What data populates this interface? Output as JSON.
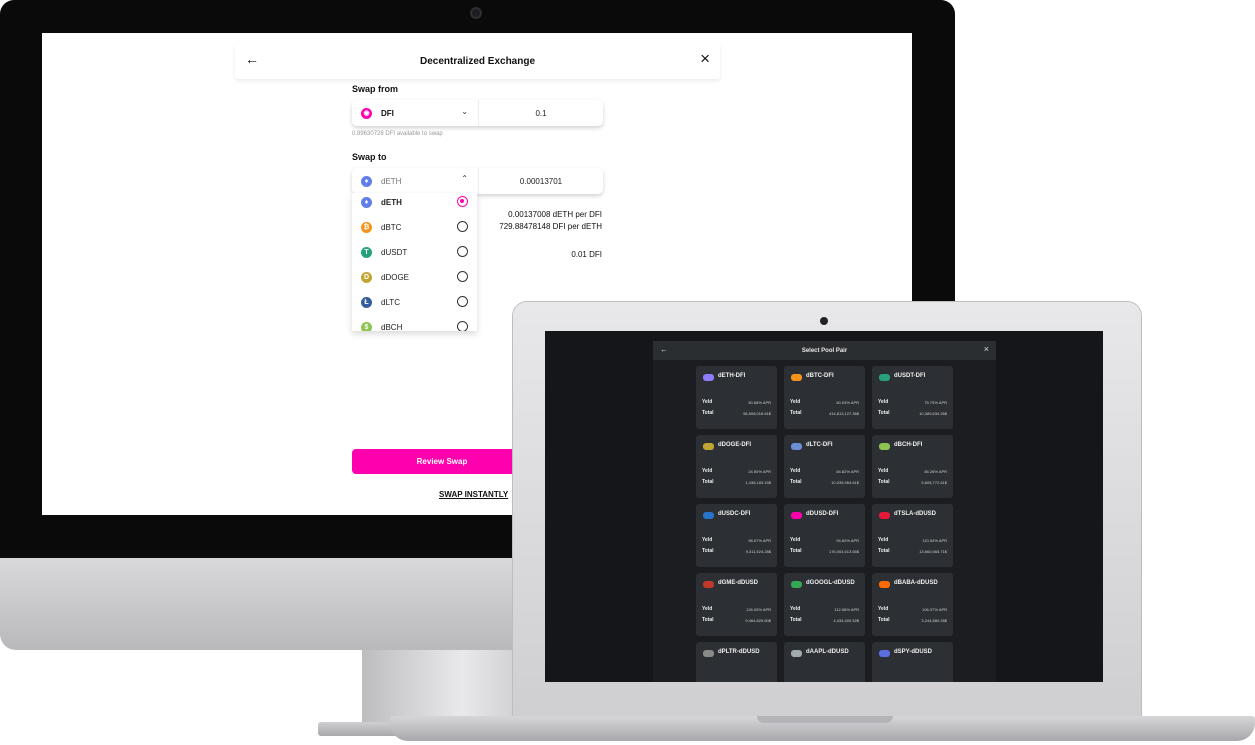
{
  "dex": {
    "title": "Decentralized Exchange",
    "swap_from_label": "Swap from",
    "from_token": "DFI",
    "from_amount": "0.1",
    "available": "0.89630728 DFI available to swap",
    "swap_to_label": "Swap to",
    "to_token": "dETH",
    "to_amount": "0.00013701",
    "rate_1": "0.00137008 dETH per DFI",
    "rate_2": "729.88478148 DFI per dETH",
    "fee": "0.01 DFI",
    "review_button": "Review Swap",
    "swap_instantly": "SWAP INSTANTLY",
    "dropdown": [
      {
        "name": "dETH",
        "icon": "eth-icon",
        "color": "#627eea",
        "selected": true
      },
      {
        "name": "dBTC",
        "icon": "btc-icon",
        "color": "#f7931a",
        "selected": false
      },
      {
        "name": "dUSDT",
        "icon": "usdt-icon",
        "color": "#26a17b",
        "selected": false
      },
      {
        "name": "dDOGE",
        "icon": "doge-icon",
        "color": "#c2a633",
        "selected": false
      },
      {
        "name": "dLTC",
        "icon": "ltc-icon",
        "color": "#345d9d",
        "selected": false
      },
      {
        "name": "dBCH",
        "icon": "bch-icon",
        "color": "#8dc351",
        "selected": false
      }
    ]
  },
  "pools": {
    "title": "Select Pool Pair",
    "yield_label": "Yeld",
    "total_label": "Total",
    "cards": [
      {
        "name": "dETH-DFI",
        "apr": "50.68% APR",
        "total": "56,508,018.61$",
        "color": "#8a7dff"
      },
      {
        "name": "dBTC-DFI",
        "apr": "60.03% APR",
        "total": "414,813,127.36$",
        "color": "#f7931a"
      },
      {
        "name": "dUSDT-DFI",
        "apr": "75.75% APR",
        "total": "10,389,634.26$",
        "color": "#26a17b"
      },
      {
        "name": "dDOGE-DFI",
        "apr": "24.50% APR",
        "total": "1,438,183.15$",
        "color": "#c2a633"
      },
      {
        "name": "dLTC-DFI",
        "apr": "84.82% APR",
        "total": "10,035,964.61$",
        "color": "#6b8fd6"
      },
      {
        "name": "dBCH-DFI",
        "apr": "85.26% APR",
        "total": "5,605,772.61$",
        "color": "#8dc351"
      },
      {
        "name": "dUSDC-DFI",
        "apr": "98.07% APR",
        "total": "9,311,524.28$",
        "color": "#2775ca"
      },
      {
        "name": "dDUSD-DFI",
        "apr": "94.60% APR",
        "total": "176,004,613.65$",
        "color": "#ff00af"
      },
      {
        "name": "dTSLA-dDUSD",
        "apr": "110.54% APR",
        "total": "13,660,665.71$",
        "color": "#e31937"
      },
      {
        "name": "dGME-dDUSD",
        "apr": "126.00% APR",
        "total": "9,464,825.60$",
        "color": "#c0392b"
      },
      {
        "name": "dGOOGL-dDUSD",
        "apr": "112.58% APR",
        "total": "4,434,400.52$",
        "color": "#34a853"
      },
      {
        "name": "dBABA-dDUSD",
        "apr": "106.37% APR",
        "total": "3,244,580.28$",
        "color": "#ff6a00"
      },
      {
        "name": "dPLTR-dDUSD",
        "apr": "",
        "total": "",
        "color": "#8a8a8a"
      },
      {
        "name": "dAAPL-dDUSD",
        "apr": "",
        "total": "",
        "color": "#a2aaad"
      },
      {
        "name": "dSPY-dDUSD",
        "apr": "",
        "total": "",
        "color": "#5b6ee1"
      }
    ]
  }
}
